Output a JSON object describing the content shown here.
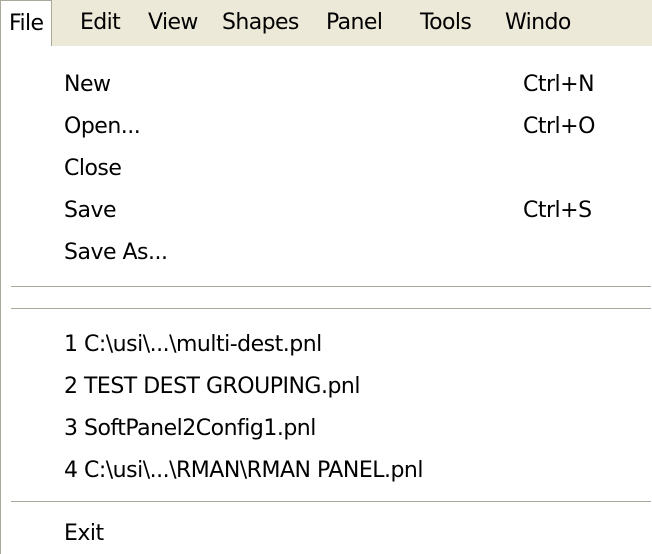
{
  "menubar": {
    "items": [
      {
        "label": "File",
        "active": true
      },
      {
        "label": "Edit"
      },
      {
        "label": "View"
      },
      {
        "label": "Shapes"
      },
      {
        "label": "Panel"
      },
      {
        "label": "Tools"
      },
      {
        "label": "Windo"
      }
    ]
  },
  "file_menu": {
    "items": [
      {
        "label": "New",
        "shortcut": "Ctrl+N"
      },
      {
        "label": "Open...",
        "shortcut": "Ctrl+O"
      },
      {
        "label": "Close",
        "shortcut": ""
      },
      {
        "label": "Save",
        "shortcut": "Ctrl+S"
      },
      {
        "label": "Save As...",
        "shortcut": ""
      }
    ],
    "recent_files": [
      {
        "label": "1 C:\\usi\\...\\multi-dest.pnl"
      },
      {
        "label": "2 TEST DEST GROUPING.pnl"
      },
      {
        "label": "3 SoftPanel2Config1.pnl"
      },
      {
        "label": "4 C:\\usi\\...\\RMAN\\RMAN PANEL.pnl"
      }
    ],
    "exit": {
      "label": "Exit"
    }
  },
  "colors": {
    "menubar_bg": "#ece9d8",
    "menu_bg": "#ffffff",
    "separator": "#aca899"
  }
}
